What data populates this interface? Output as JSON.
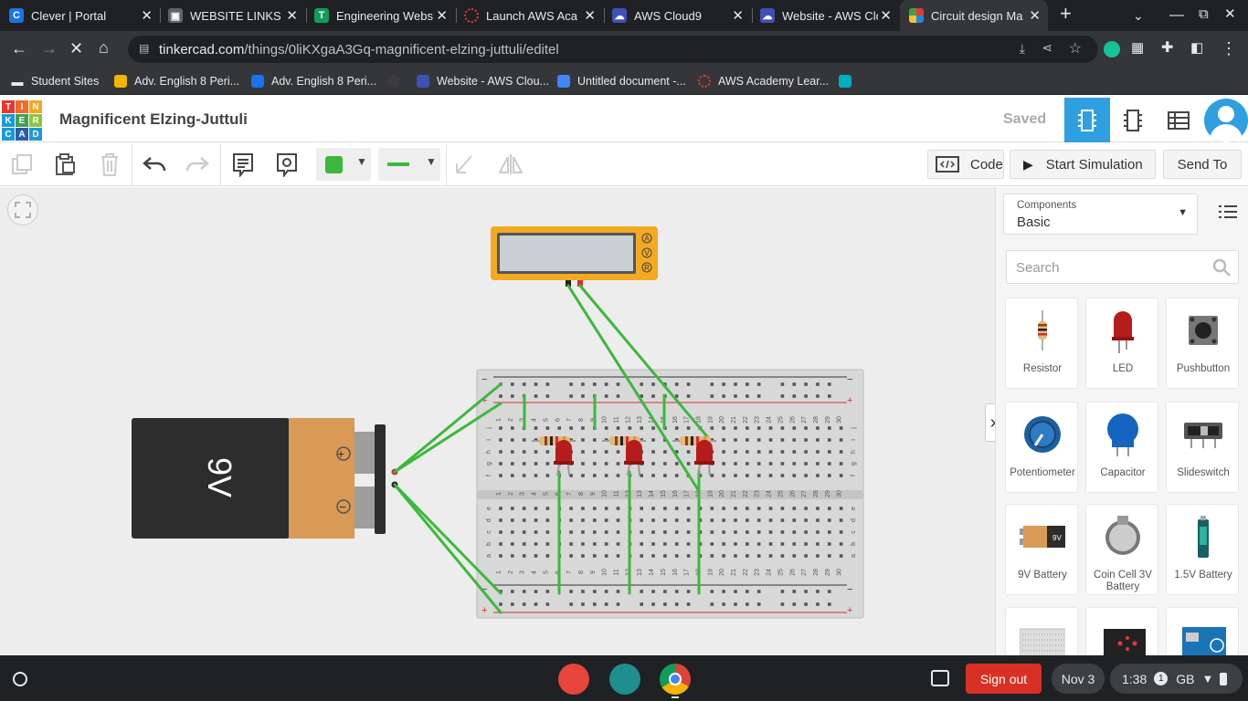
{
  "browser": {
    "tabs": [
      {
        "title": "Clever | Portal",
        "icon": "clever-icon",
        "color": "#1a73e8"
      },
      {
        "title": "WEBSITE LINKS (G",
        "icon": "classroom-icon",
        "color": "#5f6368"
      },
      {
        "title": "Engineering Webs",
        "icon": "sheets-icon",
        "color": "#0f9d58"
      },
      {
        "title": "Launch AWS Aca",
        "icon": "aws-academy-icon",
        "color": "#e53935"
      },
      {
        "title": "AWS Cloud9",
        "icon": "cloud9-icon",
        "color": "#3f51b5"
      },
      {
        "title": "Website - AWS Clo",
        "icon": "cloud9-icon",
        "color": "#3f51b5"
      },
      {
        "title": "Circuit design Ma",
        "icon": "tinkercad-icon",
        "color": "#e53935"
      }
    ],
    "url_domain": "tinkercad.com",
    "url_path": "/things/0liKXgaA3Gq-magnificent-elzing-juttuli/editel",
    "bookmarks": [
      {
        "label": "Student Sites",
        "icon": "folder-icon"
      },
      {
        "label": "Adv. English 8 Peri...",
        "icon": "classroom-icon"
      },
      {
        "label": "Adv. English 8 Peri...",
        "icon": "classroom-icon"
      },
      {
        "label": "",
        "icon": "github-icon"
      },
      {
        "label": "Website - AWS Clou...",
        "icon": "cloud9-icon"
      },
      {
        "label": "Untitled document -...",
        "icon": "docs-icon"
      },
      {
        "label": "AWS Academy Lear...",
        "icon": "aws-academy-icon"
      },
      {
        "label": "",
        "icon": "extension-bookmark-icon"
      }
    ]
  },
  "app": {
    "logo_letters": [
      "T",
      "I",
      "N",
      "K",
      "E",
      "R",
      "C",
      "A",
      "D"
    ],
    "project_title": "Magnificent Elzing-Juttuli",
    "save_status": "Saved",
    "code_label": "Code",
    "start_sim_label": "Start Simulation",
    "send_to_label": "Send To",
    "wire_color": "#3cb83c"
  },
  "canvas": {
    "battery_label": "9V",
    "battery_plus": "+",
    "battery_minus": "−",
    "meter_modes": [
      "A",
      "V",
      "R"
    ],
    "breadboard_cols": [
      "1",
      "2",
      "3",
      "4",
      "5",
      "6",
      "7",
      "8",
      "9",
      "10",
      "11",
      "12",
      "13",
      "14",
      "15",
      "16",
      "17",
      "18",
      "19",
      "20",
      "21",
      "22",
      "23",
      "24",
      "25",
      "26",
      "27",
      "28",
      "29",
      "30"
    ],
    "breadboard_rows_top": [
      "j",
      "i",
      "h",
      "g",
      "f"
    ],
    "breadboard_rows_bottom": [
      "e",
      "d",
      "c",
      "b",
      "a"
    ]
  },
  "panel": {
    "components_caption": "Components",
    "components_value": "Basic",
    "search_placeholder": "Search",
    "items": [
      {
        "label": "Resistor",
        "icon": "resistor-icon"
      },
      {
        "label": "LED",
        "icon": "led-icon"
      },
      {
        "label": "Pushbutton",
        "icon": "pushbutton-icon"
      },
      {
        "label": "Potentiometer",
        "icon": "potentiometer-icon"
      },
      {
        "label": "Capacitor",
        "icon": "capacitor-icon"
      },
      {
        "label": "Slideswitch",
        "icon": "slideswitch-icon"
      },
      {
        "label": "9V Battery",
        "icon": "battery-9v-icon"
      },
      {
        "label": "Coin Cell 3V Battery",
        "icon": "coin-cell-icon"
      },
      {
        "label": "1.5V Battery",
        "icon": "battery-aa-icon"
      },
      {
        "label": "",
        "icon": "breadboard-icon"
      },
      {
        "label": "",
        "icon": "microbit-icon"
      },
      {
        "label": "",
        "icon": "arduino-icon"
      }
    ]
  },
  "taskbar": {
    "signout_label": "Sign out",
    "date": "Nov 3",
    "time": "1:38",
    "notif_count": "1",
    "locale": "GB"
  }
}
